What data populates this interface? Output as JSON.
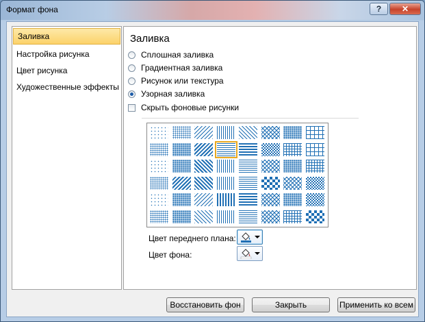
{
  "window": {
    "title": "Формат фона",
    "help_label": "?",
    "close_label": "✕"
  },
  "nav": {
    "items": [
      {
        "label": "Заливка",
        "selected": true
      },
      {
        "label": "Настройка рисунка",
        "selected": false
      },
      {
        "label": "Цвет рисунка",
        "selected": false
      },
      {
        "label": "Художественные эффекты",
        "selected": false
      }
    ]
  },
  "panel": {
    "title": "Заливка",
    "options": [
      {
        "label": "Сплошная заливка",
        "checked": false
      },
      {
        "label": "Градиентная заливка",
        "checked": false
      },
      {
        "label": "Рисунок или текстура",
        "checked": false
      },
      {
        "label": "Узорная заливка",
        "checked": true
      }
    ],
    "hide_bg": {
      "label": "Скрыть фоновые рисунки",
      "checked": false
    },
    "pattern_grid": {
      "rows": 6,
      "cols": 8,
      "selected_row": 1,
      "selected_col": 3
    },
    "foreground_label": "Цвет переднего плана:",
    "background_label": "Цвет фона:",
    "pattern_color": "#1f6fb4"
  },
  "buttons": {
    "reset": "Восстановить фон",
    "close": "Закрыть",
    "apply_all": "Применить ко всем"
  }
}
